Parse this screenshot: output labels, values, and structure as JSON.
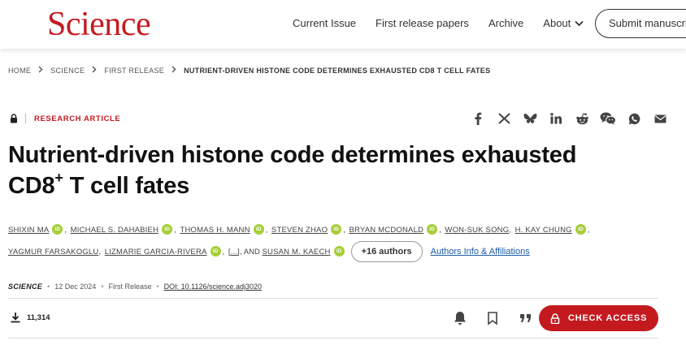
{
  "header": {
    "logo": "Science",
    "nav": [
      "Current Issue",
      "First release papers",
      "Archive"
    ],
    "about": "About",
    "submit": "Submit manuscript"
  },
  "breadcrumb": [
    "HOME",
    "SCIENCE",
    "FIRST RELEASE",
    "NUTRIENT-DRIVEN HISTONE CODE DETERMINES EXHAUSTED CD8 T CELL FATES"
  ],
  "article": {
    "type": "RESEARCH ARTICLE",
    "title_part1": "Nutrient-driven histone code determines exhausted",
    "title_part2": "CD8",
    "title_sup": "+",
    "title_part3": " T cell fates",
    "authors_line1": [
      "SHIXIN MA",
      "MICHAEL S. DAHABIEH",
      "THOMAS H. MANN",
      "STEVEN ZHAO",
      "BRYAN MCDONALD",
      "WON-SUK SONG",
      "H. KAY CHUNG"
    ],
    "authors_line2": [
      "YAGMUR FARSAKOGLU",
      "LIZMARIE GARCIA-RIVERA"
    ],
    "ellipsis": "[...]",
    "and_text": ", AND",
    "last_author": "SUSAN M. KAECH",
    "orcid": "iD",
    "more_authors": "+16 authors",
    "affiliations": "Authors Info & Affiliations",
    "journal": "SCIENCE",
    "date": "12 Dec 2024",
    "status": "First Release",
    "doi": "DOI: 10.1126/science.adj3020",
    "downloads": "11,314",
    "check_access": "CHECK ACCESS"
  },
  "icons": {
    "share": [
      "facebook-icon",
      "x-icon",
      "bluesky-icon",
      "linkedin-icon",
      "reddit-icon",
      "wechat-icon",
      "whatsapp-icon",
      "email-icon"
    ],
    "actions": [
      "bell-icon",
      "bookmark-icon",
      "quote-icon"
    ]
  },
  "colors": {
    "brand": "#c41a1f",
    "orcid": "#a6ce39",
    "link": "#1a5aa6"
  }
}
